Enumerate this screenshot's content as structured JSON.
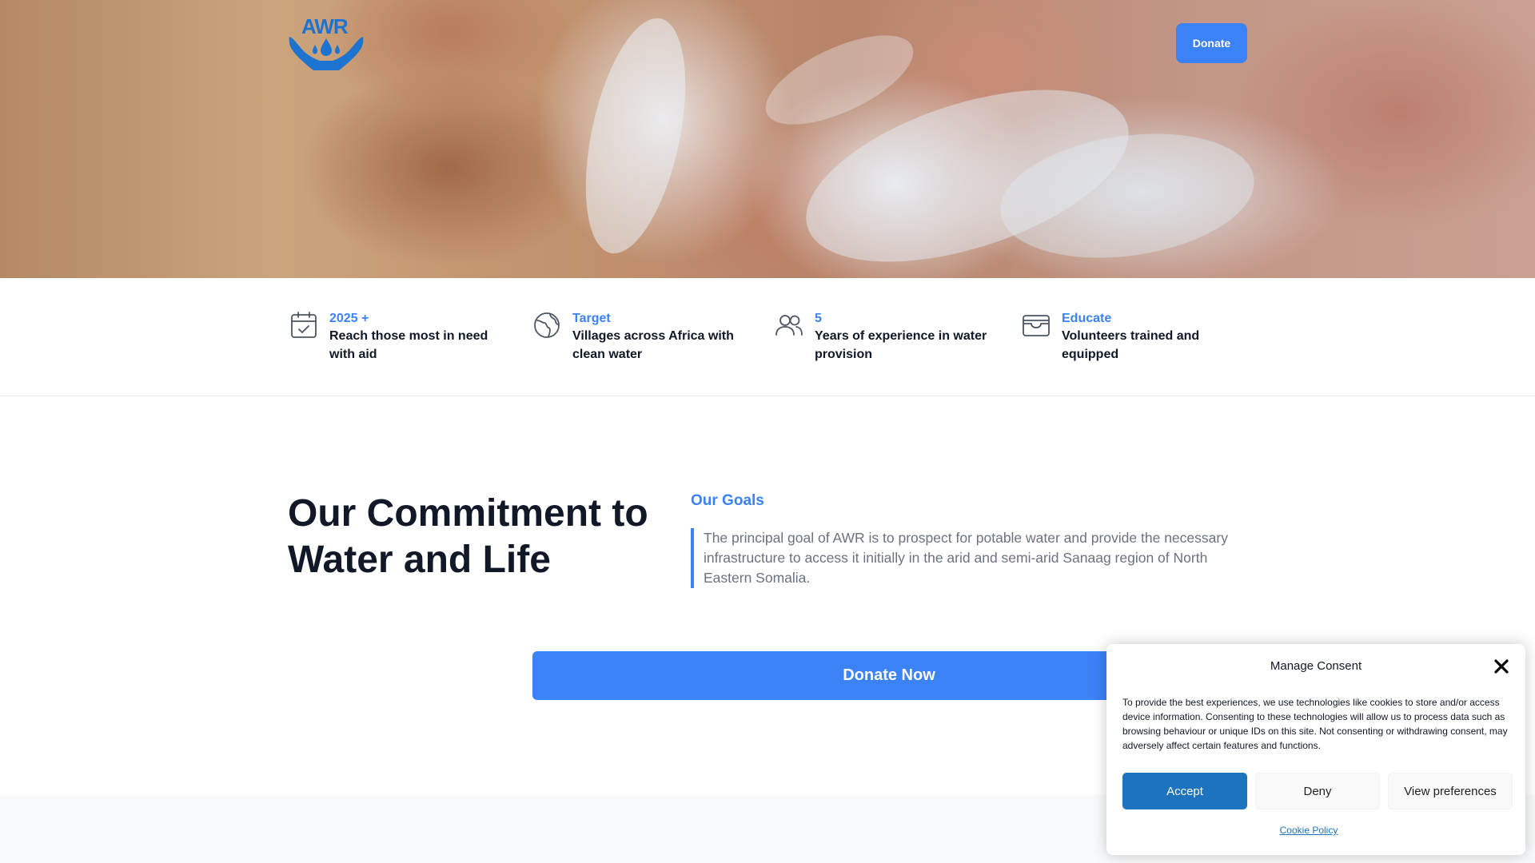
{
  "header": {
    "logo_text": "AWR",
    "donate_label": "Donate"
  },
  "stats": [
    {
      "title": "2025 +",
      "description": "Reach those most in need with aid",
      "icon": "calendar-check-icon"
    },
    {
      "title": "Target",
      "description": "Villages across Africa with clean water",
      "icon": "globe-icon"
    },
    {
      "title": "5",
      "description": "Years of experience in water provision",
      "icon": "users-icon"
    },
    {
      "title": "Educate",
      "description": "Volunteers trained and equipped",
      "icon": "card-icon"
    }
  ],
  "commitment": {
    "headline": "Our Commitment to Water and Life",
    "goals_label": "Our Goals",
    "goals_text": "The principal goal of AWR is to prospect for potable water and provide the necessary infrastructure to access it initially in the arid and semi-arid Sanaag region of North Eastern Somalia.",
    "donate_now_label": "Donate Now"
  },
  "consent": {
    "title": "Manage Consent",
    "text": "To provide the best experiences, we use technologies like cookies to store and/or access device information. Consenting to these technologies will allow us to process data such as browsing behaviour or unique IDs on this site. Not consenting or withdrawing consent, may adversely affect certain features and functions.",
    "accept_label": "Accept",
    "deny_label": "Deny",
    "preferences_label": "View preferences",
    "cookie_policy_label": "Cookie Policy"
  },
  "colors": {
    "accent": "#3b82f6",
    "logo": "#1d74d0",
    "consent_accept": "#1e73be",
    "text_dark": "#111827",
    "text_muted": "#6b7280"
  }
}
